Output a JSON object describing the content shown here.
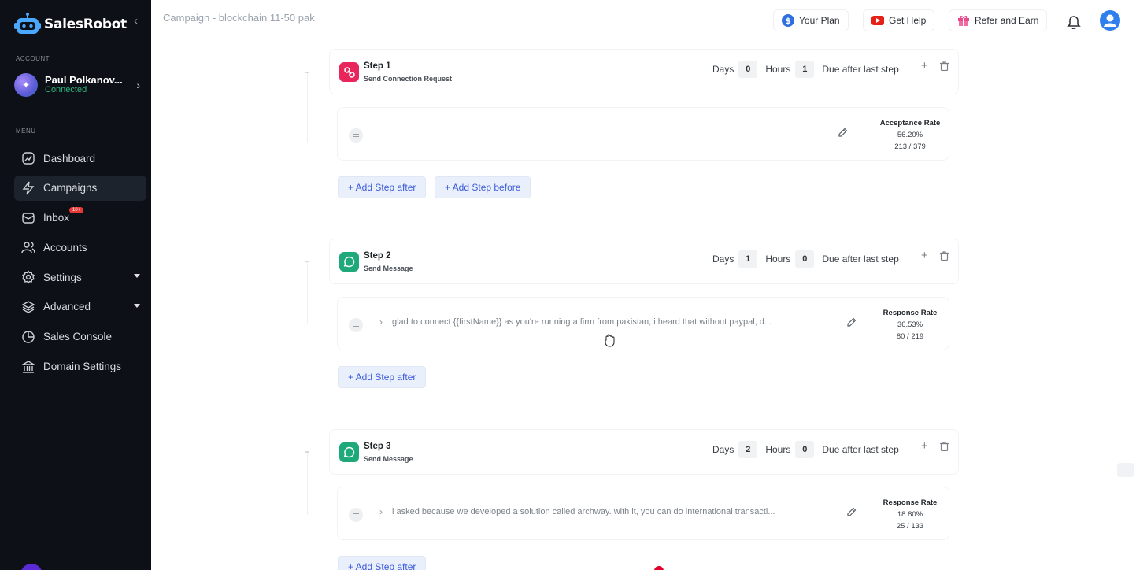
{
  "app": {
    "brand": "SalesRobot",
    "account_label": "ACCOUNT",
    "menu_label": "MENU",
    "account": {
      "name": "Paul Polkanov...",
      "status": "Connected"
    },
    "nav": [
      {
        "label": "Dashboard",
        "icon": "dashboard-icon"
      },
      {
        "label": "Campaigns",
        "icon": "lightning-icon",
        "active": true
      },
      {
        "label": "Inbox",
        "icon": "mail-icon",
        "badge": "10+"
      },
      {
        "label": "Accounts",
        "icon": "users-icon"
      },
      {
        "label": "Settings",
        "icon": "gear-icon",
        "caret": true
      },
      {
        "label": "Advanced",
        "icon": "layers-icon",
        "caret": true
      },
      {
        "label": "Sales Console",
        "icon": "pie-chart-icon"
      },
      {
        "label": "Domain Settings",
        "icon": "bank-icon"
      }
    ]
  },
  "header": {
    "title": "Campaign - blockchain 11-50 pak",
    "your_plan": "Your Plan",
    "get_help": "Get Help",
    "refer": "Refer and Earn"
  },
  "steps": [
    {
      "title": "Step 1",
      "subtitle": "Send Connection Request",
      "days_label": "Days",
      "days": "0",
      "hours_label": "Hours",
      "hours": "1",
      "due": "Due after last step",
      "message": "",
      "rate_label": "Acceptance Rate",
      "rate": "56.20%",
      "ratio": "213 / 379",
      "add_after": "+ Add Step after",
      "add_before": "+ Add Step before"
    },
    {
      "title": "Step 2",
      "subtitle": "Send Message",
      "days_label": "Days",
      "days": "1",
      "hours_label": "Hours",
      "hours": "0",
      "due": "Due after last step",
      "message": "glad to connect {{firstName}} as you're running a firm from pakistan, i heard that without paypal, d...",
      "rate_label": "Response Rate",
      "rate": "36.53%",
      "ratio": "80 / 219",
      "add_after": "+ Add Step after"
    },
    {
      "title": "Step 3",
      "subtitle": "Send Message",
      "days_label": "Days",
      "days": "2",
      "hours_label": "Hours",
      "hours": "0",
      "due": "Due after last step",
      "message": "i asked because we developed a solution called archway. with it, you can do international transacti...",
      "rate_label": "Response Rate",
      "rate": "18.80%",
      "ratio": "25 / 133",
      "add_after": "+ Add Step after"
    }
  ],
  "colors": {
    "sidebar_bg": "#0d1117",
    "connected": "#2fb67c",
    "step1_icon": "#e8265c",
    "message_icon": "#1fa97a",
    "add_button_text": "#3b5bd9"
  }
}
